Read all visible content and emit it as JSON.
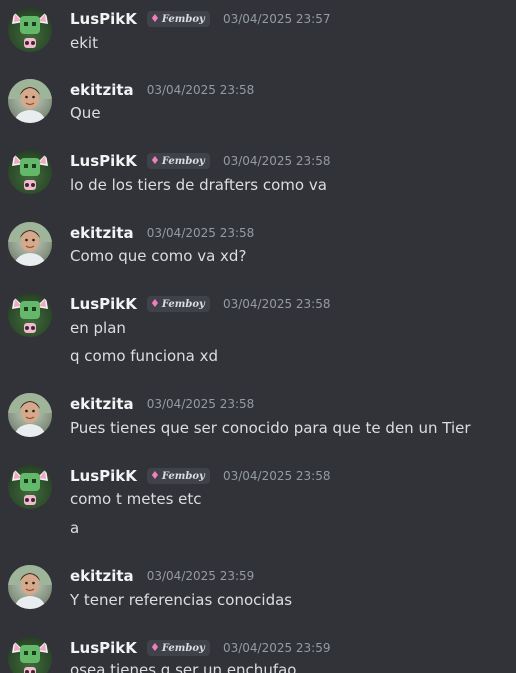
{
  "users": {
    "lus": {
      "name": "LusPikK",
      "tag": "Femboy"
    },
    "eki": {
      "name": "ekitzita"
    }
  },
  "messages": [
    {
      "author": "LusPikK",
      "tag": "Femboy",
      "time": "03/04/2025 23:57",
      "lines": [
        "ekit"
      ]
    },
    {
      "author": "ekitzita",
      "time": "03/04/2025 23:58",
      "lines": [
        "Que"
      ]
    },
    {
      "author": "LusPikK",
      "tag": "Femboy",
      "time": "03/04/2025 23:58",
      "lines": [
        "lo de los tiers de drafters como va"
      ]
    },
    {
      "author": "ekitzita",
      "time": "03/04/2025 23:58",
      "lines": [
        "Como que como va xd?"
      ]
    },
    {
      "author": "LusPikK",
      "tag": "Femboy",
      "time": "03/04/2025 23:58",
      "lines": [
        "en plan",
        "q como funciona xd"
      ]
    },
    {
      "author": "ekitzita",
      "time": "03/04/2025 23:58",
      "lines": [
        "Pues tienes que ser conocido para que te den un Tier"
      ]
    },
    {
      "author": "LusPikK",
      "tag": "Femboy",
      "time": "03/04/2025 23:58",
      "lines": [
        "como t metes etc",
        "a"
      ]
    },
    {
      "author": "ekitzita",
      "time": "03/04/2025 23:59",
      "lines": [
        "Y tener referencias conocidas"
      ]
    },
    {
      "author": "LusPikK",
      "tag": "Femboy",
      "time": "03/04/2025 23:59",
      "lines": [
        "osea tienes q ser un enchufao"
      ]
    }
  ],
  "colors": {
    "background": "#313338",
    "author": "#f2f3f5",
    "text": "#dbdee1",
    "timestamp": "#949ba4",
    "tag_bg": "#404249",
    "tag_gem": "#f27ec1"
  }
}
